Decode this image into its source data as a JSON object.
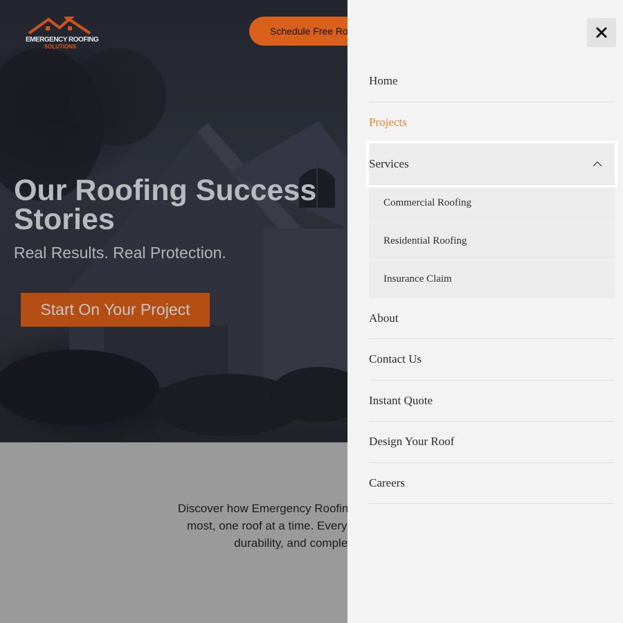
{
  "brand": {
    "logo_line1": "EMERGENCY ROOFING",
    "logo_line2": "SOLUTIONS",
    "accent": "#d9601a"
  },
  "header": {
    "schedule_button": "Schedule Free Ro"
  },
  "hero": {
    "title": "Our Roofing Success Stories",
    "subtitle": "Real Results. Real Protection.",
    "cta": "Start On Your Project"
  },
  "intro": {
    "line1": "Discover how Emergency Roofing Solutions has he",
    "line2": "most, one roof at a time. Every project is a testa",
    "line3": "durability, and complete custo"
  },
  "menu": {
    "close_icon": "close-icon",
    "items": [
      {
        "label": "Home"
      },
      {
        "label": "Projects",
        "active": true
      },
      {
        "label": "Services",
        "expanded": true,
        "icon": "chevron-up-icon"
      },
      {
        "label": "About"
      },
      {
        "label": "Contact Us"
      },
      {
        "label": "Instant Quote"
      },
      {
        "label": "Design Your Roof"
      },
      {
        "label": "Careers"
      }
    ],
    "services_submenu": [
      {
        "label": "Commercial Roofing"
      },
      {
        "label": "Residential Roofing"
      },
      {
        "label": "Insurance Claim"
      }
    ],
    "active_color": "#e8842c"
  }
}
